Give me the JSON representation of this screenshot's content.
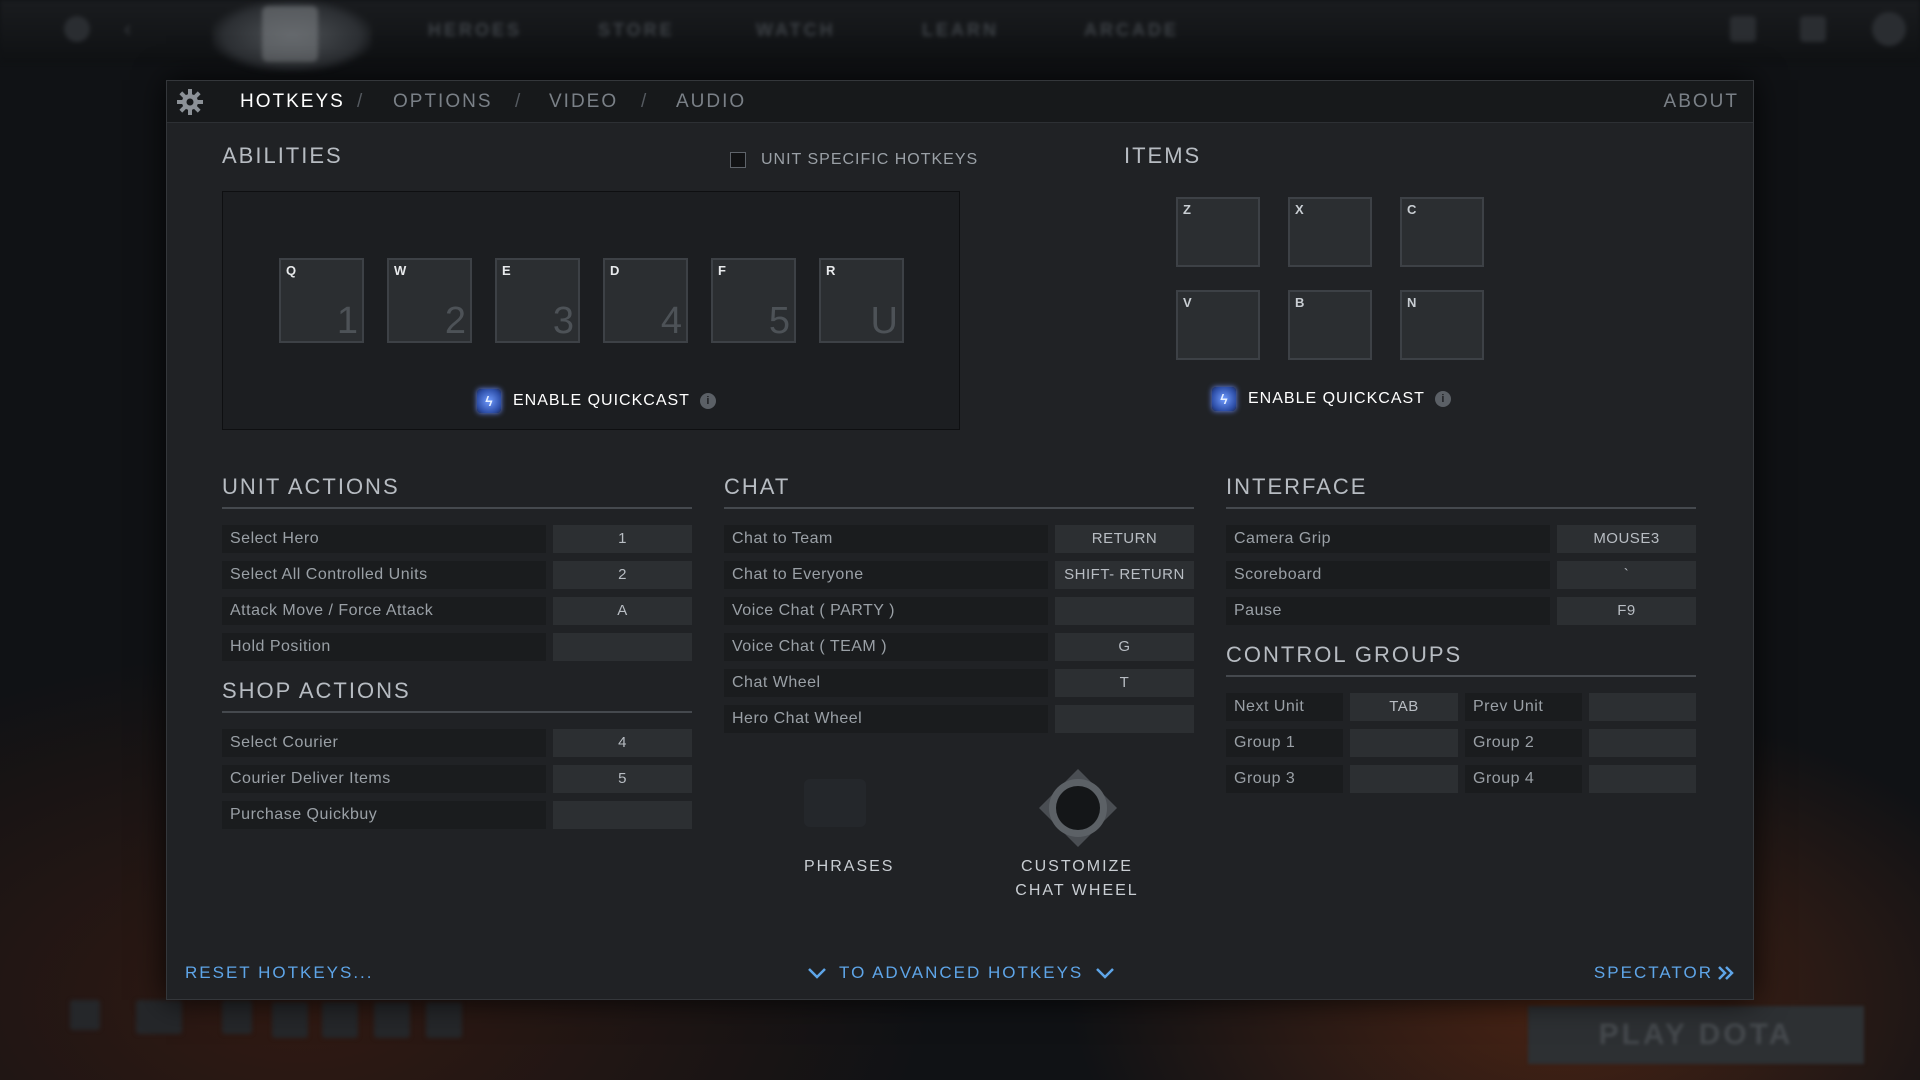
{
  "top_nav": [
    "HEROES",
    "STORE",
    "WATCH",
    "LEARN",
    "ARCADE"
  ],
  "play_button": "PLAY DOTA",
  "tabs": {
    "hotkeys": "HOTKEYS",
    "options": "OPTIONS",
    "video": "VIDEO",
    "audio": "AUDIO",
    "separator": "/",
    "about": "ABOUT"
  },
  "abilities": {
    "title": "ABILITIES",
    "unit_specific_label": "UNIT SPECIFIC HOTKEYS",
    "slots": [
      {
        "key": "Q",
        "num": "1"
      },
      {
        "key": "W",
        "num": "2"
      },
      {
        "key": "E",
        "num": "3"
      },
      {
        "key": "D",
        "num": "4"
      },
      {
        "key": "F",
        "num": "5"
      },
      {
        "key": "R",
        "num": "U"
      }
    ],
    "quickcast_label": "ENABLE QUICKCAST"
  },
  "items": {
    "title": "ITEMS",
    "slots": [
      "Z",
      "X",
      "C",
      "V",
      "B",
      "N"
    ],
    "quickcast_label": "ENABLE QUICKCAST"
  },
  "unit_actions": {
    "title": "UNIT ACTIONS",
    "rows": [
      {
        "label": "Select Hero",
        "key": "1"
      },
      {
        "label": "Select All Controlled Units",
        "key": "2"
      },
      {
        "label": "Attack Move / Force Attack",
        "key": "A"
      },
      {
        "label": "Hold Position",
        "key": ""
      }
    ]
  },
  "shop_actions": {
    "title": "SHOP ACTIONS",
    "rows": [
      {
        "label": "Select Courier",
        "key": "4"
      },
      {
        "label": "Courier Deliver Items",
        "key": "5"
      },
      {
        "label": "Purchase Quickbuy",
        "key": ""
      }
    ]
  },
  "chat": {
    "title": "CHAT",
    "rows": [
      {
        "label": "Chat to Team",
        "key": "RETURN"
      },
      {
        "label": "Chat to Everyone",
        "key": "SHIFT- RETURN"
      },
      {
        "label": "Voice Chat ( PARTY )",
        "key": ""
      },
      {
        "label": "Voice Chat ( TEAM )",
        "key": "G"
      },
      {
        "label": "Chat Wheel",
        "key": "T"
      },
      {
        "label": "Hero Chat Wheel",
        "key": ""
      }
    ],
    "phrases_label": "PHRASES",
    "customize_line1": "CUSTOMIZE",
    "customize_line2": "CHAT WHEEL"
  },
  "interface": {
    "title": "INTERFACE",
    "rows": [
      {
        "label": "Camera Grip",
        "key": "MOUSE3"
      },
      {
        "label": "Scoreboard",
        "key": "`"
      },
      {
        "label": "Pause",
        "key": "F9"
      }
    ]
  },
  "control_groups": {
    "title": "CONTROL GROUPS",
    "rows": [
      {
        "label": "Next Unit",
        "key": "TAB",
        "label2": "Prev Unit",
        "key2": ""
      },
      {
        "label": "Group 1",
        "key": "",
        "label2": "Group 2",
        "key2": ""
      },
      {
        "label": "Group 3",
        "key": "",
        "label2": "Group 4",
        "key2": ""
      }
    ]
  },
  "footer": {
    "reset": "RESET HOTKEYS...",
    "advanced": "TO ADVANCED HOTKEYS",
    "spectator": "SPECTATOR"
  },
  "colors": {
    "panel_bg": "#202225",
    "accent_link": "#5ea5e8",
    "quickcast_glow": "#6a8dff"
  }
}
